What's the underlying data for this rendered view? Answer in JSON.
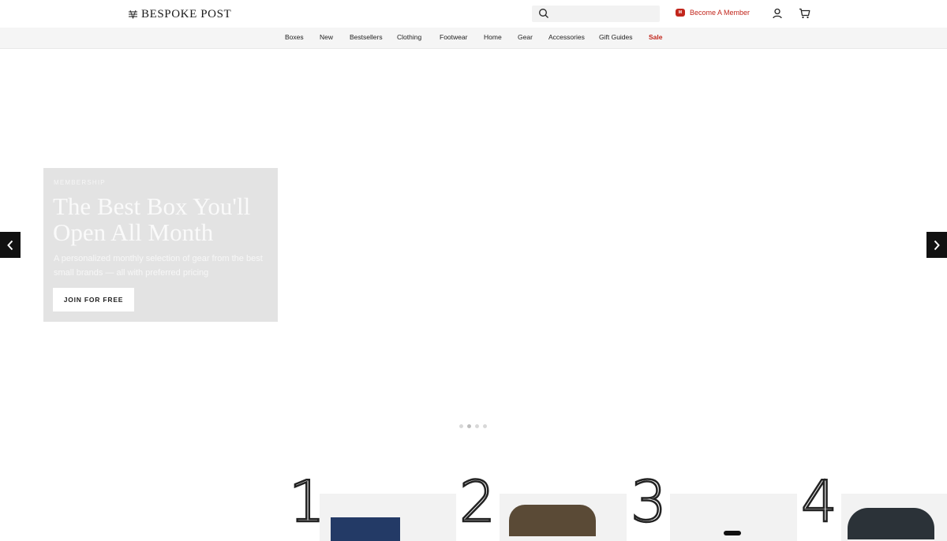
{
  "header": {
    "logo_text": "BESPOKE POST",
    "member_badge": "M",
    "member_label": "Become A Member",
    "search_placeholder": ""
  },
  "nav": {
    "items": [
      "Boxes",
      "New",
      "Bestsellers",
      "Clothing",
      "Footwear",
      "Home",
      "Gear",
      "Accessories",
      "Gift Guides",
      "Sale"
    ]
  },
  "hero": {
    "eyebrow": "MEMBERSHIP",
    "title": "The Best Box You'll Open All Month",
    "subtitle": "A personalized monthly selection of gear from the best small brands — all with preferred pricing",
    "cta_label": "JOIN FOR FREE",
    "slides": 4,
    "active_slide": 2
  },
  "steps": [
    "1",
    "2",
    "3",
    "4"
  ],
  "colors": {
    "accent": "#c2261c",
    "nav_bg": "#f5f5f5",
    "hero_card_bg": "#e3e3e3"
  },
  "icons": {
    "search": "search-icon",
    "account": "user-icon",
    "cart": "cart-icon",
    "prev": "chevron-left-icon",
    "next": "chevron-right-icon"
  }
}
